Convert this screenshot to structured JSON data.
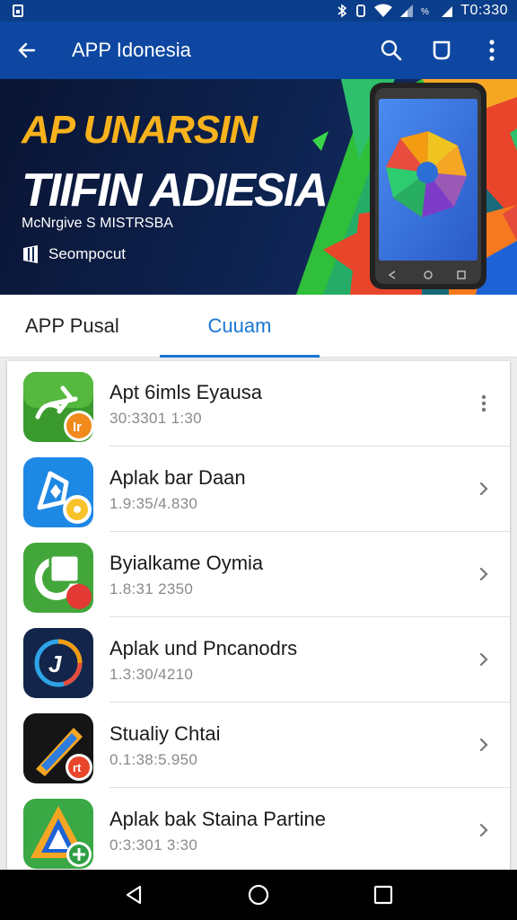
{
  "status": {
    "time": "T0:330"
  },
  "appbar": {
    "title": "APP Idonesia"
  },
  "banner": {
    "headline1": "AP UNARSIN",
    "headline2": "TIIFIN ADIESIA",
    "subtitle": "McNrgive S MISTRSBA",
    "badge": "Seompocut"
  },
  "tabs": [
    {
      "label": "APP Pusal",
      "selected": false
    },
    {
      "label": "Cuuam",
      "selected": true
    }
  ],
  "apps": [
    {
      "name": "Apt 6imls Eyausa",
      "version": "30:3301 1:30",
      "icon": "plane-icon"
    },
    {
      "name": "Aplak bar Daan",
      "version": "1.9:35/4.830",
      "icon": "shield-icon"
    },
    {
      "name": "Byialkame Oymia",
      "version": "1.8:31 2350",
      "icon": "crop-icon"
    },
    {
      "name": "Aplak und Pncanodrs",
      "version": "1.3:30/4210",
      "icon": "compass-icon"
    },
    {
      "name": "Stualiy Chtai",
      "version": "0.1:38:5.950",
      "icon": "pencil-icon"
    },
    {
      "name": "Aplak bak Staina Partine",
      "version": "0:3:301 3:30",
      "icon": "triangle-icon"
    }
  ],
  "colors": {
    "primary": "#0d47a1",
    "accent": "#1976d2",
    "banner_yellow": "#f7b21c"
  }
}
